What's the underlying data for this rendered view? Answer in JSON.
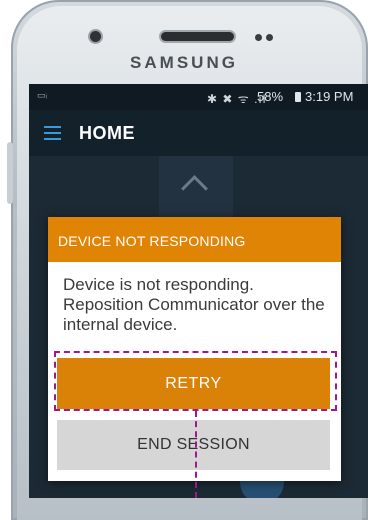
{
  "device": {
    "brand": "SAMSUNG"
  },
  "status_bar": {
    "left_icon": "▭ᵢ",
    "connectivity_icons": "✱ ✖ ᯤ .ıl",
    "battery": "58%",
    "time": "3:19 PM"
  },
  "app_bar": {
    "menu_icon": "hamburger-menu-icon",
    "title": "HOME"
  },
  "dialog": {
    "title": "DEVICE NOT RESPONDING",
    "message": "Device is not responding. Reposition Communicator over the internal device.",
    "retry_label": "RETRY",
    "end_session_label": "END SESSION"
  },
  "colors": {
    "dialog_header": "#e08406",
    "retry_button": "#d98207",
    "end_session_button": "#d6d6d6",
    "highlight": "#a3178c",
    "menu_icon": "#3a9ae0",
    "screen_bg": "#1a2630"
  }
}
